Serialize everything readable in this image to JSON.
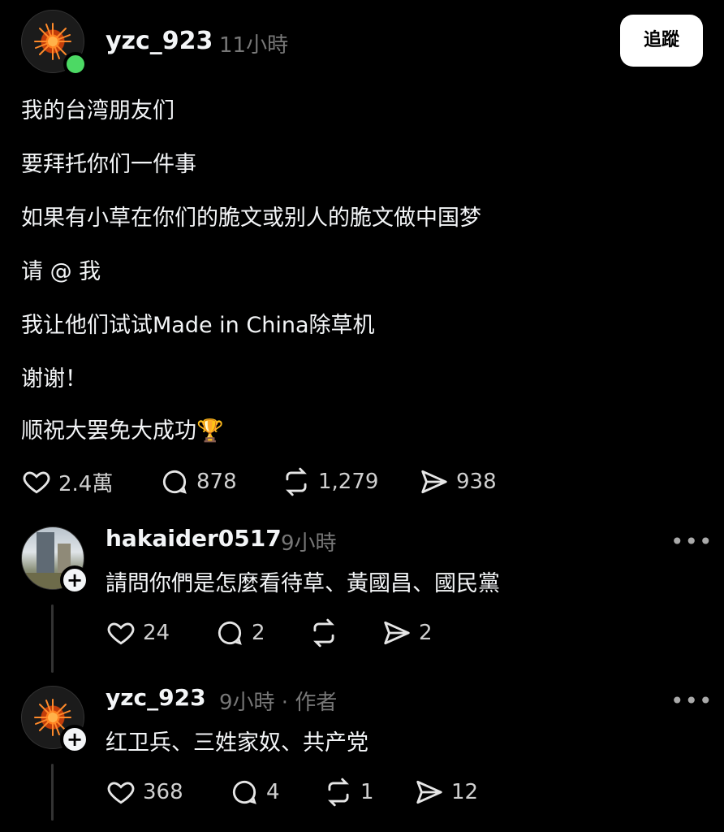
{
  "post": {
    "username": "yzc_923",
    "time": "11小時",
    "follow_label": "追蹤",
    "lines": [
      "我的台湾朋友们",
      "要拜托你们一件事",
      "如果有小草在你们的脆文或别人的脆文做中国梦",
      "请 @ 我",
      "我让他们试试Made in China除草机",
      "谢谢！",
      "顺祝大罢免大成功🏆"
    ],
    "likes": "2.4萬",
    "comments": "878",
    "reposts": "1,279",
    "shares": "938"
  },
  "replies": [
    {
      "username": "hakaider0517",
      "time": "9小時",
      "text": "請問你們是怎麼看待草、黃國昌、國民黨",
      "likes": "24",
      "comments": "2",
      "reposts": "",
      "shares": "2",
      "more": "•••"
    },
    {
      "username": "yzc_923",
      "time": "9小時 · 作者",
      "text": "红卫兵、三姓家奴、共产党",
      "likes": "368",
      "comments": "4",
      "reposts": "1",
      "shares": "12",
      "more": "•••"
    }
  ],
  "colors": {
    "background": "#000000",
    "text": "#f3f5f7",
    "muted": "#777777",
    "online": "#4cd964"
  },
  "icons": [
    "heart-icon",
    "comment-bubble-icon",
    "repost-icon",
    "share-send-icon",
    "more-dots-icon",
    "plus-icon"
  ]
}
